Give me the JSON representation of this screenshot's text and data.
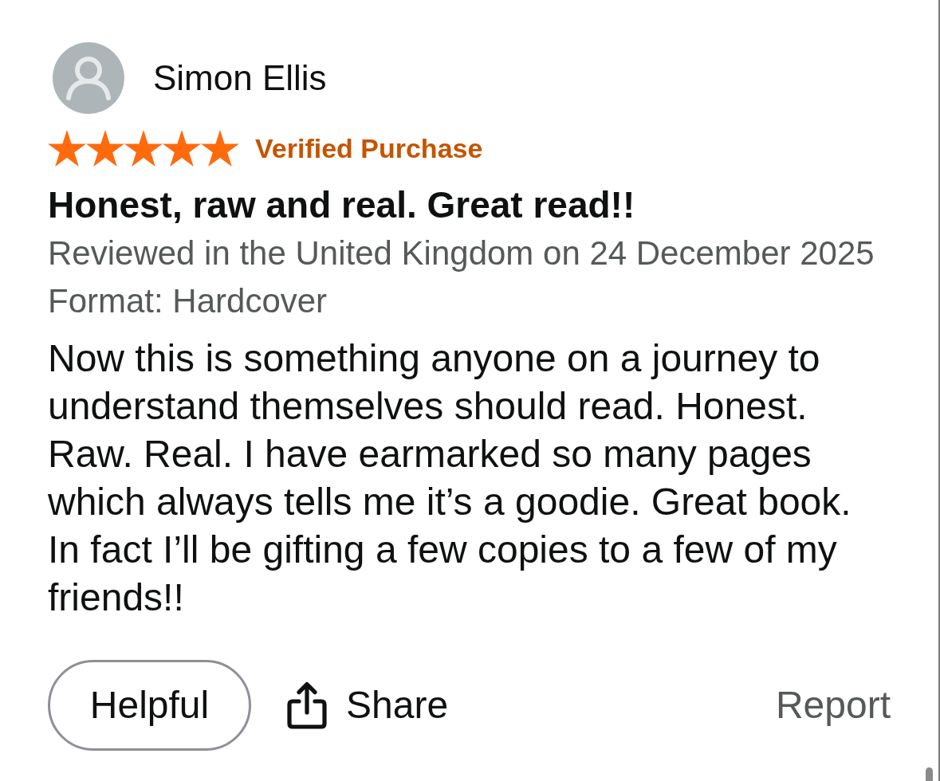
{
  "review": {
    "reviewer": {
      "name": "Simon Ellis"
    },
    "stars": 5,
    "badge": "Verified Purchase",
    "title": "Honest, raw and real. Great read!!",
    "meta": "Reviewed in the United Kingdom on 24 December 2025",
    "format": "Format: Hardcover",
    "body": "Now this is something anyone on a journey to understand themselves should read. Honest. Raw. Real. I have earmarked so many pages which always tells me it’s a goodie. Great book. In fact I’ll be gifting a few copies to a few of my friends!!"
  },
  "actions": [
    {
      "kind": "pill",
      "label": "Helpful"
    },
    {
      "kind": "share",
      "label": "Share"
    },
    {
      "kind": "plain",
      "label": "Report"
    }
  ]
}
